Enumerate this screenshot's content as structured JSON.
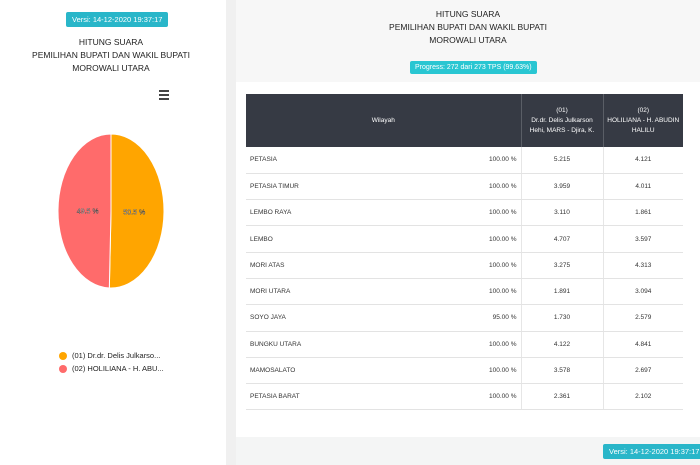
{
  "left": {
    "version": "Versi: 14-12-2020 19:37:17",
    "title_lines": [
      "HITUNG SUARA",
      "PEMILIHAN BUPATI DAN WAKIL BUPATI",
      "MOROWALI UTARA"
    ],
    "menu_icon": "hamburger-icon",
    "legend": [
      {
        "label": "(01) Dr.dr. Delis Julkarso...",
        "color": "#ffa500"
      },
      {
        "label": "(02) HOLILIANA - H. ABU...",
        "color": "#ff6b6b"
      }
    ]
  },
  "chart_data": {
    "type": "pie",
    "series": [
      {
        "label": "50.5 %",
        "value": 50.5,
        "color": "#ffa500"
      },
      {
        "label": "49.5 %",
        "value": 49.5,
        "color": "#ff6b6b"
      }
    ]
  },
  "right": {
    "title_lines": [
      "HITUNG SUARA",
      "PEMILIHAN BUPATI DAN WAKIL BUPATI",
      "MOROWALI UTARA"
    ],
    "progress": "Progress: 272 dari 273 TPS (99.63%)",
    "table": {
      "headers": {
        "region": "Wilayah",
        "c1_line1": "(01)",
        "c1_line2": "Dr.dr. Delis Julkarson",
        "c1_line3": "Hehi, MARS - Djira, K.",
        "c2_line1": "(02)",
        "c2_line2": "HOLILIANA - H. ABUDIN",
        "c2_line3": "HALILU"
      },
      "rows": [
        {
          "region": "PETASIA",
          "pct": "100.00 %",
          "c1": "5.215",
          "c2": "4.121"
        },
        {
          "region": "PETASIA TIMUR",
          "pct": "100.00 %",
          "c1": "3.959",
          "c2": "4.011"
        },
        {
          "region": "LEMBO RAYA",
          "pct": "100.00 %",
          "c1": "3.110",
          "c2": "1.861"
        },
        {
          "region": "LEMBO",
          "pct": "100.00 %",
          "c1": "4.707",
          "c2": "3.597"
        },
        {
          "region": "MORI ATAS",
          "pct": "100.00 %",
          "c1": "3.275",
          "c2": "4.313"
        },
        {
          "region": "MORI UTARA",
          "pct": "100.00 %",
          "c1": "1.891",
          "c2": "3.094"
        },
        {
          "region": "SOYO JAYA",
          "pct": "95.00 %",
          "c1": "1.730",
          "c2": "2.579"
        },
        {
          "region": "BUNGKU UTARA",
          "pct": "100.00 %",
          "c1": "4.122",
          "c2": "4.841"
        },
        {
          "region": "MAMOSALATO",
          "pct": "100.00 %",
          "c1": "3.578",
          "c2": "2.697"
        },
        {
          "region": "PETASIA BARAT",
          "pct": "100.00 %",
          "c1": "2.361",
          "c2": "2.102"
        }
      ]
    },
    "version": "Versi: 14-12-2020 19:37:17"
  }
}
